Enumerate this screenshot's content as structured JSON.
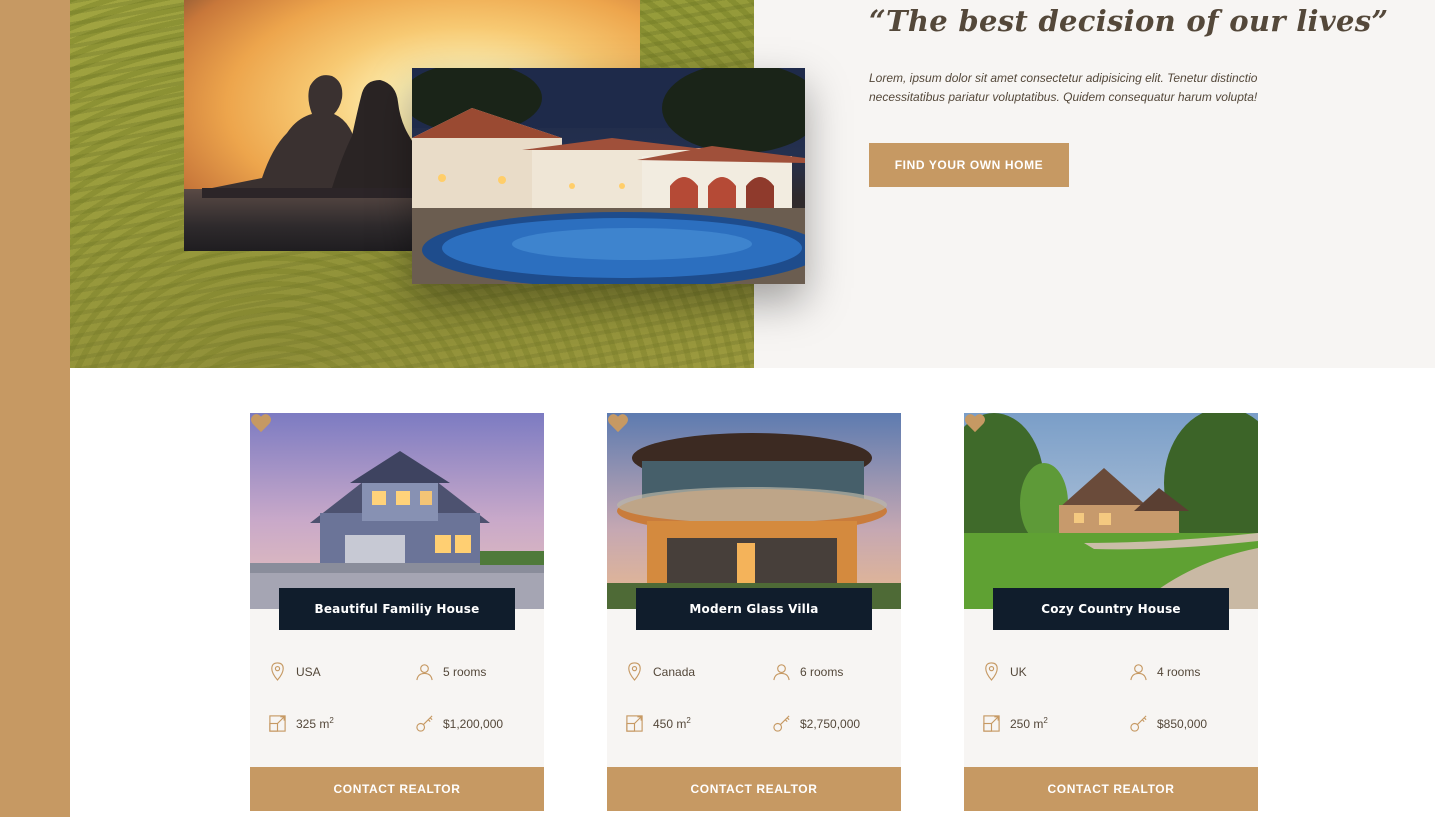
{
  "hero": {
    "quote_title": "“The best decision of our lives”",
    "quote_text": "Lorem, ipsum dolor sit amet consectetur adipisicing elit. Tenetur distinctio necessitatibus pariatur voluptatibus. Quidem consequatur harum volupta!",
    "find_button": "FIND YOUR OWN HOME"
  },
  "colors": {
    "accent": "#c69963",
    "dark": "#101d2c",
    "text": "#54483a",
    "light_bg": "#f7f5f3"
  },
  "homes": [
    {
      "name": "Beautiful Familiy House",
      "location": "USA",
      "rooms": "5 rooms",
      "area": "325 m",
      "area_unit_exp": "2",
      "price": "$1,200,000",
      "contact": "CONTACT REALTOR",
      "favorite_icon": "heart-icon"
    },
    {
      "name": "Modern Glass Villa",
      "location": "Canada",
      "rooms": "6 rooms",
      "area": "450 m",
      "area_unit_exp": "2",
      "price": "$2,750,000",
      "contact": "CONTACT REALTOR",
      "favorite_icon": "heart-icon"
    },
    {
      "name": "Cozy Country House",
      "location": "UK",
      "rooms": "4 rooms",
      "area": "250 m",
      "area_unit_exp": "2",
      "price": "$850,000",
      "contact": "CONTACT REALTOR",
      "favorite_icon": "heart-icon"
    }
  ],
  "icons": {
    "location": "map-pin-icon",
    "rooms": "user-icon",
    "area": "expand-icon",
    "price": "key-icon"
  }
}
